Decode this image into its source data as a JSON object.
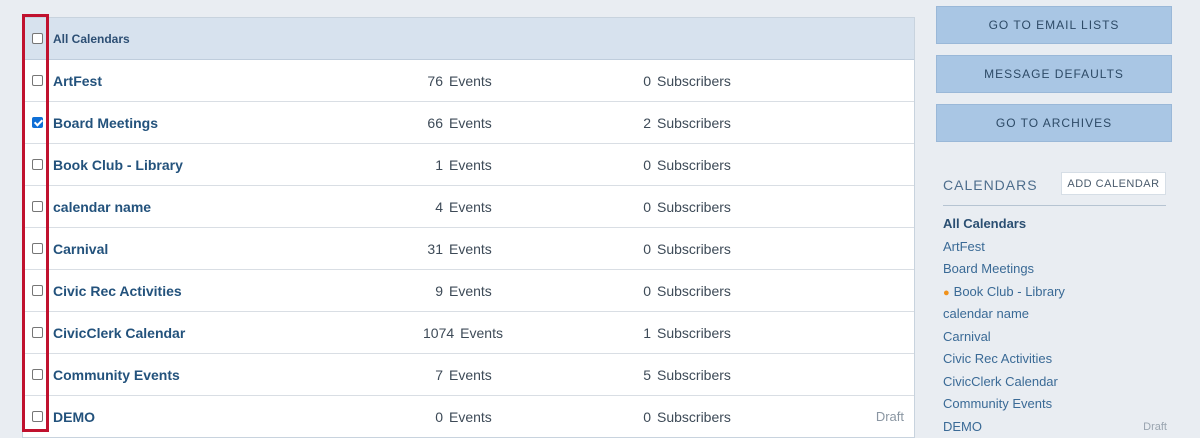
{
  "table": {
    "header_label": "All Calendars",
    "rows": [
      {
        "name": "ArtFest",
        "events": "76",
        "events_label": "Events",
        "subscribers": "0",
        "subscribers_label": "Subscribers",
        "status": "",
        "checked": false
      },
      {
        "name": "Board Meetings",
        "events": "66",
        "events_label": "Events",
        "subscribers": "2",
        "subscribers_label": "Subscribers",
        "status": "",
        "checked": true
      },
      {
        "name": "Book Club - Library",
        "events": "1",
        "events_label": "Events",
        "subscribers": "0",
        "subscribers_label": "Subscribers",
        "status": "",
        "checked": false
      },
      {
        "name": "calendar name",
        "events": "4",
        "events_label": "Events",
        "subscribers": "0",
        "subscribers_label": "Subscribers",
        "status": "",
        "checked": false
      },
      {
        "name": "Carnival",
        "events": "31",
        "events_label": "Events",
        "subscribers": "0",
        "subscribers_label": "Subscribers",
        "status": "",
        "checked": false
      },
      {
        "name": "Civic Rec Activities",
        "events": "9",
        "events_label": "Events",
        "subscribers": "0",
        "subscribers_label": "Subscribers",
        "status": "",
        "checked": false
      },
      {
        "name": "CivicClerk Calendar",
        "events": "1074",
        "events_label": "Events",
        "subscribers": "1",
        "subscribers_label": "Subscribers",
        "status": "",
        "checked": false
      },
      {
        "name": "Community Events",
        "events": "7",
        "events_label": "Events",
        "subscribers": "5",
        "subscribers_label": "Subscribers",
        "status": "",
        "checked": false
      },
      {
        "name": "DEMO",
        "events": "0",
        "events_label": "Events",
        "subscribers": "0",
        "subscribers_label": "Subscribers",
        "status": "Draft",
        "checked": false
      }
    ]
  },
  "sidebar": {
    "buttons": [
      "GO TO EMAIL LISTS",
      "MESSAGE DEFAULTS",
      "GO TO ARCHIVES"
    ],
    "calendars_title": "CALENDARS",
    "add_calendar_label": "ADD CALENDAR",
    "items": [
      {
        "label": "All Calendars",
        "active": true,
        "dot": false,
        "status": ""
      },
      {
        "label": "ArtFest",
        "active": false,
        "dot": false,
        "status": ""
      },
      {
        "label": "Board Meetings",
        "active": false,
        "dot": false,
        "status": ""
      },
      {
        "label": "Book Club - Library",
        "active": false,
        "dot": true,
        "status": ""
      },
      {
        "label": "calendar name",
        "active": false,
        "dot": false,
        "status": ""
      },
      {
        "label": "Carnival",
        "active": false,
        "dot": false,
        "status": ""
      },
      {
        "label": "Civic Rec Activities",
        "active": false,
        "dot": false,
        "status": ""
      },
      {
        "label": "CivicClerk Calendar",
        "active": false,
        "dot": false,
        "status": ""
      },
      {
        "label": "Community Events",
        "active": false,
        "dot": false,
        "status": ""
      },
      {
        "label": "DEMO",
        "active": false,
        "dot": false,
        "status": "Draft"
      }
    ]
  },
  "colors": {
    "highlight_box": "#c0112e",
    "accent_dot": "#f0921c",
    "button_bg": "#a9c6e4",
    "header_bg": "#d7e2ee"
  },
  "icons": {
    "checkbox": "checkbox-icon",
    "status_dot": "bullet-dot-icon"
  }
}
